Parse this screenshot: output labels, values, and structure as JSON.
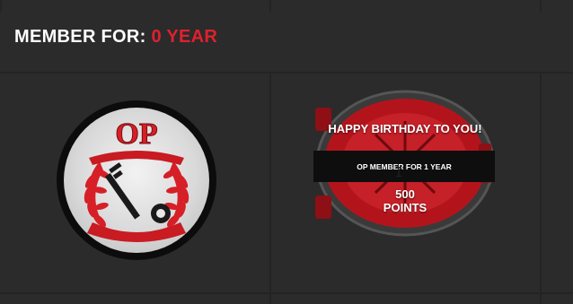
{
  "header": {
    "label": "MEMBER FOR:",
    "value": "0 YEAR",
    "accent_color": "#e0202e"
  },
  "badge": {
    "logo_text": "OP",
    "icon": "key-laurel-icon"
  },
  "reward": {
    "title": "HAPPY BIRTHDAY TO YOU!",
    "subtitle": "OP MEMBER FOR 1 YEAR",
    "points_value": "500",
    "points_label": "POINTS",
    "icon": "vault-door-icon"
  }
}
